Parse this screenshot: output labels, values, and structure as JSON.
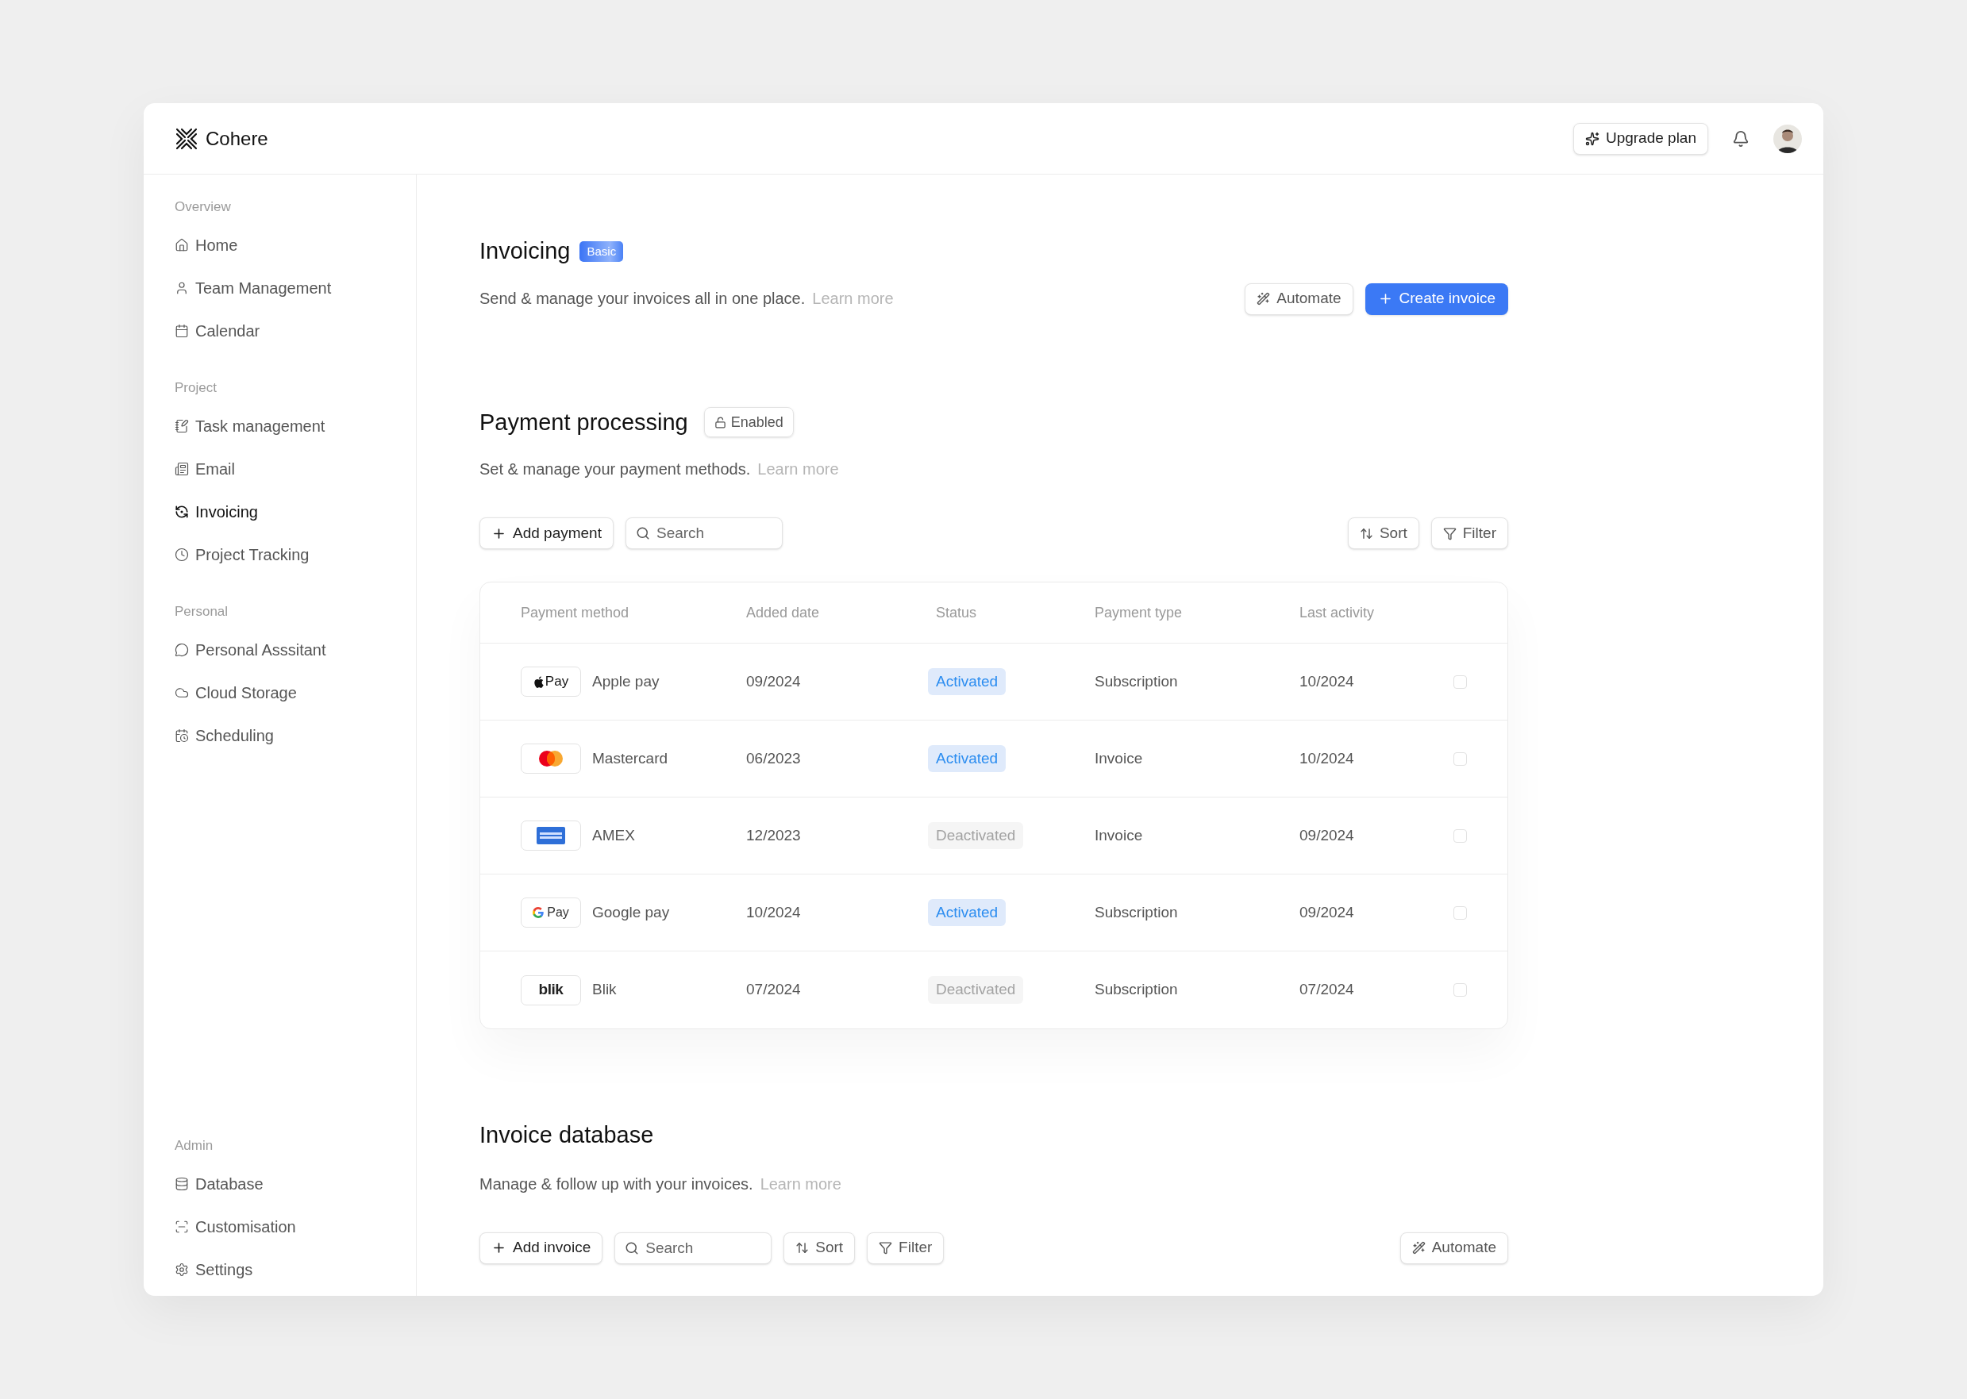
{
  "brand": {
    "name": "Cohere"
  },
  "header": {
    "upgrade_button": "Upgrade plan"
  },
  "sidebar": {
    "groups": [
      {
        "title": "Overview",
        "items": [
          {
            "label": "Home",
            "kind": "home",
            "selected": false
          },
          {
            "label": "Team Management",
            "kind": "user",
            "selected": false
          },
          {
            "label": "Calendar",
            "kind": "calendar",
            "selected": false
          }
        ]
      },
      {
        "title": "Project",
        "items": [
          {
            "label": "Task management",
            "kind": "task",
            "selected": false
          },
          {
            "label": "Email",
            "kind": "email",
            "selected": false
          },
          {
            "label": "Invoicing",
            "kind": "invoice",
            "selected": true
          },
          {
            "label": "Project Tracking",
            "kind": "clock",
            "selected": false
          }
        ]
      },
      {
        "title": "Personal",
        "items": [
          {
            "label": "Personal Asssitant",
            "kind": "chat",
            "selected": false
          },
          {
            "label": "Cloud Storage",
            "kind": "cloud",
            "selected": false
          },
          {
            "label": "Scheduling",
            "kind": "schedule",
            "selected": false
          }
        ]
      },
      {
        "title": "Admin",
        "items": [
          {
            "label": "Database",
            "kind": "database",
            "selected": false
          },
          {
            "label": "Customisation",
            "kind": "scan",
            "selected": false
          },
          {
            "label": "Settings",
            "kind": "settings",
            "selected": false
          }
        ]
      }
    ]
  },
  "invoicing": {
    "title": "Invoicing",
    "badge": "Basic",
    "description": "Send & manage your invoices all in one place.",
    "link": "Learn more",
    "automate_button": "Automate",
    "create_button": "Create invoice"
  },
  "payment_processing": {
    "title": "Payment processing",
    "status": "Enabled",
    "description": "Set & manage your payment methods.",
    "link": "Learn more",
    "add_button": "Add payment",
    "search": {
      "placeholder": "Search"
    },
    "sort_button": "Sort",
    "filter_button": "Filter",
    "table": {
      "columns": [
        "Payment method",
        "Added date",
        "Status",
        "Payment type",
        "Last activity"
      ],
      "rows": [
        {
          "logo": {
            "kind": "apple",
            "text": "Pay"
          },
          "method": "Apple pay",
          "added": "09/2024",
          "status": "Activated",
          "active": true,
          "type": "Subscription",
          "last": "10/2024",
          "checked": false
        },
        {
          "logo": {
            "kind": "mastercard"
          },
          "method": "Mastercard",
          "added": "06/2023",
          "status": "Activated",
          "active": true,
          "type": "Invoice",
          "last": "10/2024",
          "checked": false
        },
        {
          "logo": {
            "kind": "amex"
          },
          "method": "AMEX",
          "added": "12/2023",
          "status": "Deactivated",
          "active": false,
          "type": "Invoice",
          "last": "09/2024",
          "checked": false
        },
        {
          "logo": {
            "kind": "google",
            "text": "Pay"
          },
          "method": "Google pay",
          "added": "10/2024",
          "status": "Activated",
          "active": true,
          "type": "Subscription",
          "last": "09/2024",
          "checked": false
        },
        {
          "logo": {
            "kind": "blik",
            "text": "blik"
          },
          "method": "Blik",
          "added": "07/2024",
          "status": "Deactivated",
          "active": false,
          "type": "Subscription",
          "last": "07/2024",
          "checked": false
        }
      ]
    }
  },
  "invoice_database": {
    "title": "Invoice database",
    "description": "Manage & follow up with your invoices.",
    "link": "Learn more",
    "add_button": "Add invoice",
    "search": {
      "placeholder": "Search"
    },
    "sort_button": "Sort",
    "filter_button": "Filter",
    "automate_button": "Automate"
  }
}
